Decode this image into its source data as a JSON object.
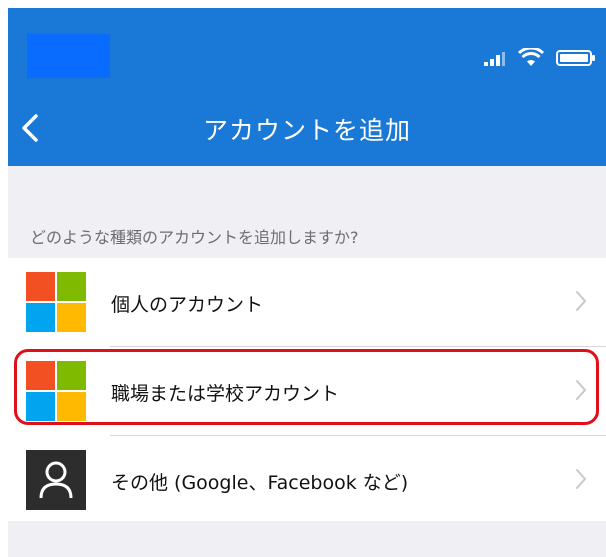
{
  "header": {
    "title": "アカウントを追加",
    "back_icon": "chevron-left-icon",
    "bg_color": "#1a78d6"
  },
  "status_bar": {
    "icons": [
      "signal-bars-icon",
      "wifi-icon",
      "battery-icon"
    ]
  },
  "prompt": "どのような種類のアカウントを追加しますか?",
  "options": [
    {
      "label": "個人のアカウント",
      "icon": "microsoft-logo-icon"
    },
    {
      "label": "職場または学校アカウント",
      "icon": "microsoft-logo-icon",
      "highlighted": true
    },
    {
      "label": "その他 (Google、Facebook など)",
      "icon": "person-icon"
    }
  ],
  "colors": {
    "ms_red": "#f25022",
    "ms_green": "#7fba00",
    "ms_blue": "#00a4ef",
    "ms_yellow": "#ffb900",
    "highlight": "#e0101a"
  }
}
